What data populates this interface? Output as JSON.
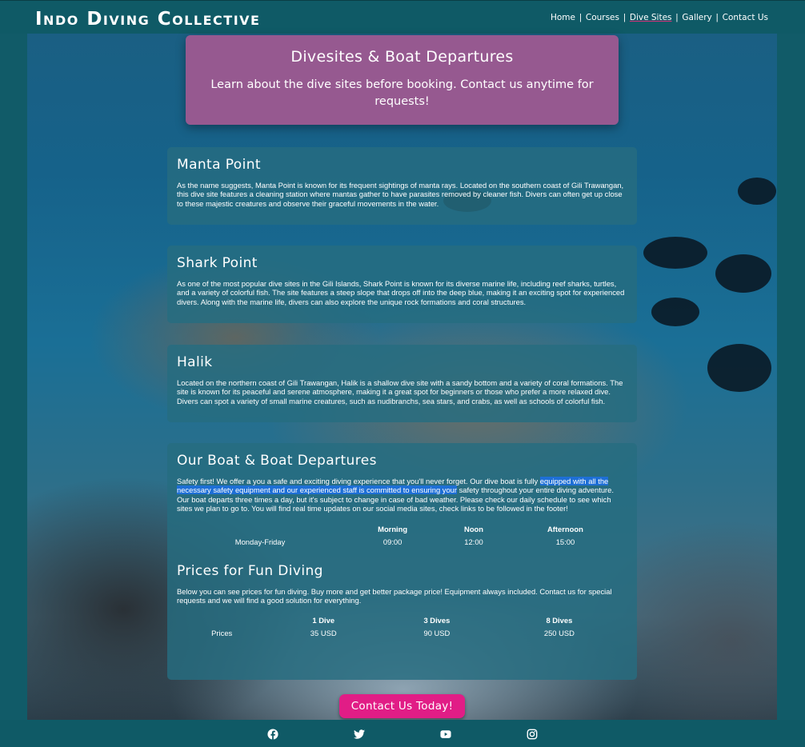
{
  "brand": "Indo Diving Collective",
  "nav": {
    "items": [
      "Home",
      "Courses",
      "Dive Sites",
      "Gallery",
      "Contact Us"
    ],
    "active": "Dive Sites",
    "accent": "#d9317a"
  },
  "header": {
    "title": "Divesites & Boat Departures",
    "subtitle": "Learn about the dive sites before booking. Contact us anytime for requests!"
  },
  "sites": [
    {
      "name": "Manta Point",
      "description": "As the name suggests, Manta Point is known for its frequent sightings of manta rays. Located on the southern coast of Gili Trawangan, this dive site features a cleaning station where mantas gather to have parasites removed by cleaner fish. Divers can often get up close to these majestic creatures and observe their graceful movements in the water."
    },
    {
      "name": "Shark Point",
      "description": "As one of the most popular dive sites in the Gili Islands, Shark Point is known for its diverse marine life, including reef sharks, turtles, and a variety of colorful fish. The site features a steep slope that drops off into the deep blue, making it an exciting spot for experienced divers. Along with the marine life, divers can also explore the unique rock formations and coral structures."
    },
    {
      "name": "Halik",
      "description": "Located on the northern coast of Gili Trawangan, Halik is a shallow dive site with a sandy bottom and a variety of coral formations. The site is known for its peaceful and serene atmosphere, making it a great spot for beginners or those who prefer a more relaxed dive. Divers can spot a variety of small marine creatures, such as nudibranchs, sea stars, and crabs, as well as schools of colorful fish."
    }
  ],
  "boat": {
    "title": "Our Boat & Boat Departures",
    "intro_before": "Safety first! We offer a you a safe and exciting diving experience that you'll never forget. Our dive boat is fully ",
    "intro_selected": "equipped with all the necessary safety equipment and our experienced staff is committed to ensuring your",
    "intro_after": " safety throughout your entire diving adventure.",
    "departures_text": "Our boat departs three times a day, but it's subject to change in case of bad weather. Please check our daily schedule to see which sites we plan to go to. You will find real time updates on our social media sites, check links to be followed in the footer!",
    "schedule": {
      "headers": [
        "",
        "Morning",
        "Noon",
        "Afternoon"
      ],
      "row": [
        "Monday-Friday",
        "09:00",
        "12:00",
        "15:00"
      ]
    }
  },
  "prices": {
    "title": "Prices for Fun Diving",
    "text": "Below you can see prices for fun diving. Buy more and get better package price! Equipment always included. Contact us for special requests and we will find a good solution for everything.",
    "headers": [
      "",
      "1 Dive",
      "3 Dives",
      "8 Dives"
    ],
    "row": [
      "Prices",
      "35 USD",
      "90 USD",
      "250 USD"
    ]
  },
  "cta": "Contact Us Today!",
  "cta_color": "#e11d86",
  "social": [
    "facebook-icon",
    "twitter-icon",
    "youtube-icon",
    "instagram-icon"
  ]
}
